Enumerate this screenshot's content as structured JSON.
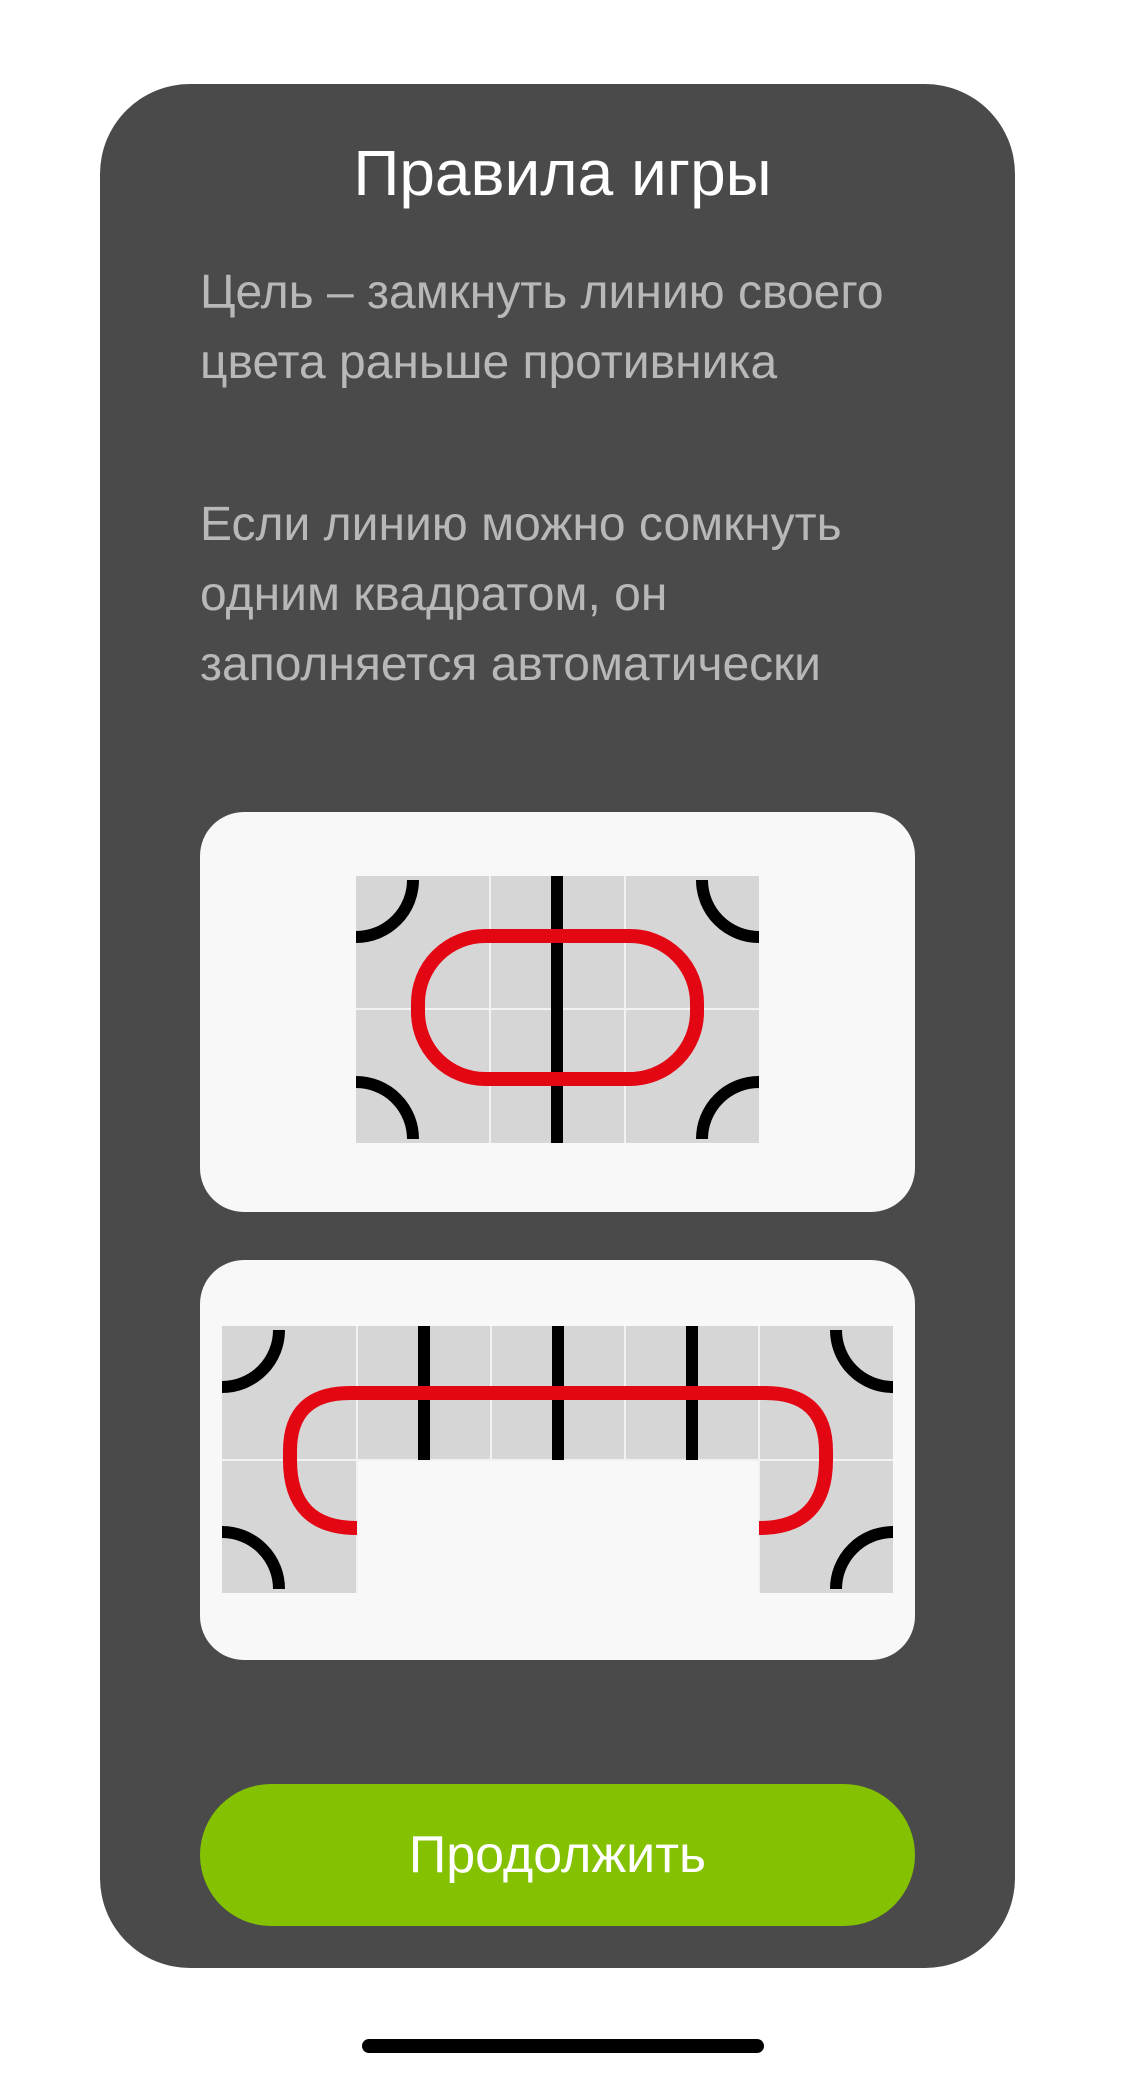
{
  "rules": {
    "title": "Правила игры",
    "paragraph_goal": "Цель – замкнуть линию своего цвета раньше противника",
    "paragraph_autofill": "Если линию можно сомкнуть одним квадратом, он заполняется автоматически",
    "continue_label": "Продолжить"
  },
  "colors": {
    "modal_bg": "#4a4a4a",
    "panel_bg": "#f8f8f8",
    "tile_bg": "#d6d6d6",
    "player_line": "#e30613",
    "opponent_line": "#000000",
    "continue_button": "#84c100"
  },
  "examples": [
    {
      "name": "closed-loop-example",
      "grid": "3x2",
      "description_icon": "red-loop-crossing-black-line"
    },
    {
      "name": "autofill-example",
      "grid": "5x2",
      "description_icon": "red-path-over-gap"
    }
  ]
}
